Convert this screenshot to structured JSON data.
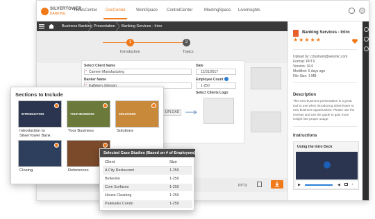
{
  "app": {
    "logo_line1": "SILVERTOWER",
    "logo_line2": "BANKING"
  },
  "nav": {
    "items": [
      "NewsCenter",
      "DocCenter",
      "WorkSpace",
      "ControlCenter",
      "MeetingSpace",
      "LiveInsights"
    ],
    "active": "DocCenter"
  },
  "breadcrumb": [
    "Business Banking",
    "Presentation",
    "Banking Services - Intro"
  ],
  "steps": [
    {
      "number": "1",
      "label": "Introduction"
    },
    {
      "number": "2",
      "label": "Topics"
    }
  ],
  "form": {
    "client_name_label": "Select Client Name",
    "client_name_value": "Carmen Manufacturing",
    "date_label": "Date",
    "date_value": "12/31/2017",
    "banker_label": "Banker Name",
    "banker_value": "Kathleen Johnson",
    "employee_count_label": "Employee Count",
    "employee_count_value": "1-250",
    "logos_label": "Select Clients Logo",
    "upload_label": "UPLOAD"
  },
  "bottom": {
    "format": "PPTX"
  },
  "details": {
    "doc_title": "Banking Services - Intro",
    "stars": "★★★★★",
    "uploaded_by": "Upload by: cdunham@seismic.com",
    "format": "Format: PPTX",
    "version": "Version: 16.0",
    "modified": "Modified: 6 days ago",
    "file_size": "File Size: 1 MB",
    "description_heading": "Description",
    "description_text": "This new business presentation is a great tool to use when introducing SilverTower to new business opportunities. Please use the reviews and use the guide to gain more insight into proper usage.",
    "instructions_heading": "Instructions",
    "video_title": "Using the Intro Deck"
  },
  "sections": {
    "heading": "Sections to Include",
    "items": [
      {
        "label": "Introduction to SilverTower Bank",
        "thumb_text": "INTRODUCTION",
        "color": "#2b3550"
      },
      {
        "label": "Your Business",
        "thumb_text": "YOUR BUSINESS",
        "color": "#6b7a3a"
      },
      {
        "label": "Solutions",
        "thumb_text": "SOLUTIONS",
        "color": "#c88a3a"
      },
      {
        "label": "Closing",
        "thumb_text": "",
        "color": "#2d3f5c"
      },
      {
        "label": "References",
        "thumb_text": "",
        "color": "#7a4a2a"
      }
    ]
  },
  "case_studies": {
    "heading": "Selected Case Studies (Based on # of Employees)",
    "col_client": "Client",
    "col_size": "Size",
    "rows": [
      {
        "client": "A City Restaurant",
        "size": "1-250"
      },
      {
        "client": "Bellavino",
        "size": "1-250"
      },
      {
        "client": "Core Surfaces",
        "size": "1-250"
      },
      {
        "client": "House Cleaning",
        "size": "1-250"
      },
      {
        "client": "Palekaiko Condo",
        "size": "1-250"
      }
    ]
  },
  "colors": {
    "accent": "#f07a1a",
    "dark_bar": "#3a3a3a"
  }
}
